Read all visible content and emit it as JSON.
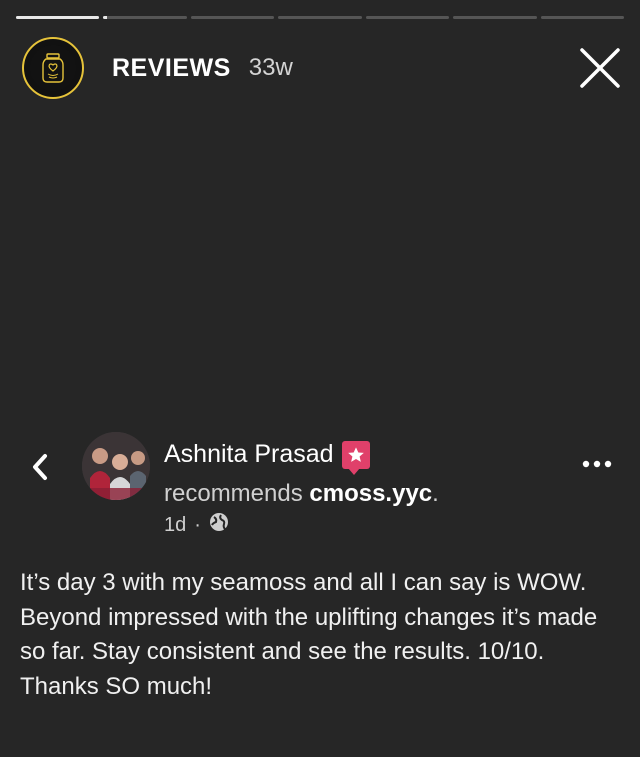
{
  "story": {
    "account_name": "REVIEWS",
    "age": "33w",
    "ring_color": "#e6c33a",
    "progress_segments": [
      1,
      0.04,
      0,
      0,
      0,
      0,
      0
    ]
  },
  "review": {
    "reviewer_name": "Ashnita Prasad",
    "recommends_word": "recommends",
    "page_name": "cmoss.yyc",
    "period": ".",
    "time": "1d",
    "separator": "·",
    "visibility_icon": "globe-icon",
    "badge_color": "#e0406a",
    "text": "It’s day 3 with my seamoss and all I can say is WOW. Beyond impressed with the uplifting changes it’s made so far. Stay consistent and see the results. 10/10. Thanks SO much!"
  }
}
